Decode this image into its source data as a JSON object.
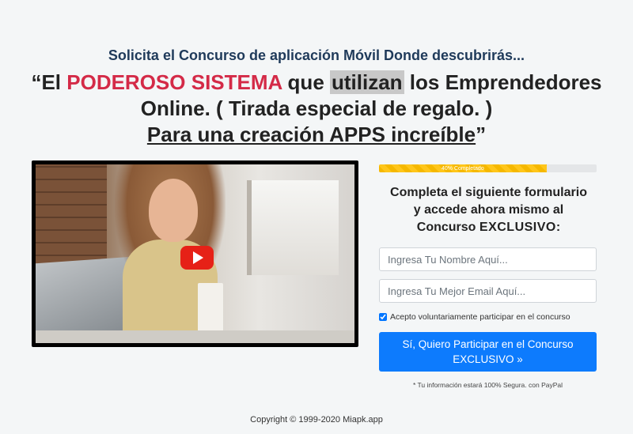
{
  "subheadline": "Solicita el Concurso de aplicación Móvil Donde descubrirás...",
  "headline": {
    "open_quote": "“El ",
    "highlight_red": "PODEROSO SISTEMA",
    "mid1": " que ",
    "highlight_gray": "utilizan",
    "mid2": " los Emprendedores Online. ( Tirada especial de regalo. )",
    "underlined": "Para una creación APPS increíble",
    "close_quote": "”"
  },
  "video": {
    "play_icon": "youtube-play-icon"
  },
  "progress": {
    "label": "40% Completado",
    "value": 0.77,
    "color": "#f5b800"
  },
  "form": {
    "title_line1": "Completa el siguiente formulario",
    "title_line2": "y accede ahora mismo al",
    "title_line3a": "Concurso ",
    "title_line3b": "EXCLUSIVO",
    "title_line3c": ":",
    "name_placeholder": "Ingresa Tu Nombre Aquí...",
    "email_placeholder": "Ingresa Tu Mejor Email Aquí...",
    "consent_label": "Acepto voluntariamente participar en el concurso",
    "submit_line1": "Sí, Quiero Participar en el Concurso",
    "submit_line2": "EXCLUSIVO »",
    "secure_note": "* Tu información estará 100% Segura. con PayPal",
    "button_color": "#0d7bfd"
  },
  "footer": {
    "copyright": "Copyright © 1999-2020 Miapk.app"
  }
}
